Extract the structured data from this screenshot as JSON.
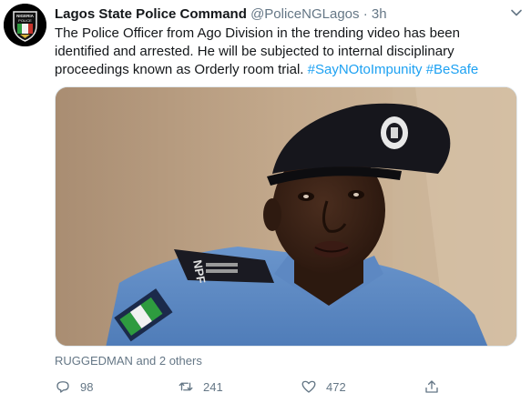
{
  "tweet": {
    "author_name": "Lagos State Police Command",
    "handle": "@PoliceNGLagos",
    "separator": "·",
    "time": "3h",
    "text_main": "The Police Officer from Ago Division in the trending video has been identified and arrested. He will be subjected to internal disciplinary proceedings known as Orderly room trial. ",
    "hashtag_1": "#SayNOtoImpunity",
    "hashtag_2": "#BeSafe",
    "liked_by": "RUGGEDMAN and 2 others",
    "replies": "98",
    "retweets": "241",
    "likes": "472"
  },
  "avatar": {
    "logo_text_top": "NIGERIA",
    "logo_text_bottom": "POLICE"
  },
  "media": {
    "badge_text": "NPF"
  },
  "colors": {
    "accent": "#1da1f2",
    "muted": "#657786",
    "text": "#14171a"
  },
  "icons": [
    "chevron-down-icon",
    "reply-icon",
    "retweet-icon",
    "like-icon",
    "share-icon"
  ]
}
